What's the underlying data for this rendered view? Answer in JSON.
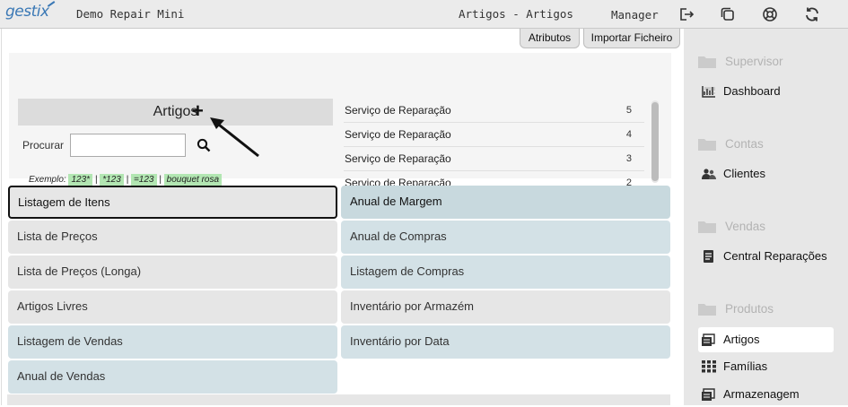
{
  "header": {
    "logo": "gestix",
    "app_title": "Demo Repair Mini",
    "page_title": "Artigos - Artigos",
    "user": "Manager",
    "icons": [
      "logout-icon",
      "windows-icon",
      "help-lifebuoy-icon",
      "refresh-icon"
    ]
  },
  "toolbar": {
    "atributos_label": "Atributos",
    "importar_label": "Importar Ficheiro"
  },
  "artigos": {
    "title": "Artigos",
    "add_symbol": "+",
    "search_label": "Procurar",
    "search_value": "",
    "examples_label": "Exemplo:",
    "examples": [
      "123*",
      "*123",
      "=123",
      "bouquet rosa"
    ],
    "separator": "|"
  },
  "recent": [
    {
      "name": "Serviço de Reparação",
      "qty": "5"
    },
    {
      "name": "Serviço de Reparação",
      "qty": "4"
    },
    {
      "name": "Serviço de Reparação",
      "qty": "3"
    },
    {
      "name": "Serviço de Reparação",
      "qty": "2"
    }
  ],
  "reports_left": [
    "Listagem de Itens",
    "Lista de Preços",
    "Lista de Preços (Longa)",
    "Artigos Livres",
    "Listagem de Vendas",
    "Anual de Vendas"
  ],
  "reports_right": [
    "Anual de Margem",
    "Anual de Compras",
    "Listagem de Compras",
    "Inventário por Armazém",
    "Inventário por Data"
  ],
  "sidebar": {
    "sections": [
      {
        "title": "Supervisor",
        "items": [
          "Dashboard"
        ]
      },
      {
        "title": "Contas",
        "items": [
          "Clientes"
        ]
      },
      {
        "title": "Vendas",
        "items": [
          "Central Reparações"
        ]
      },
      {
        "title": "Produtos",
        "items": [
          "Artigos",
          "Famílias",
          "Armazenagem"
        ]
      }
    ],
    "active": "Artigos"
  },
  "colors": {
    "accent": "#3a78b5",
    "tile_gray": "#e6e6e6",
    "tile_blue": "#d3e1e6",
    "example_green": "#b2e6b2"
  }
}
